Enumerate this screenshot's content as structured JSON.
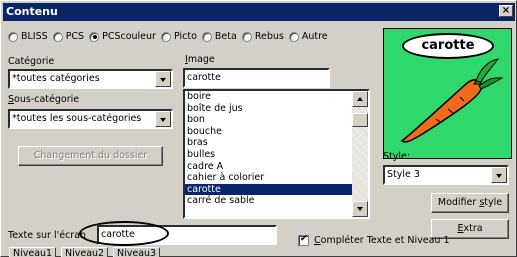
{
  "window": {
    "title": "Contenu",
    "close_label": "×"
  },
  "symbol_sets": [
    {
      "label": "BLISS",
      "selected": false
    },
    {
      "label": "PCS",
      "selected": false
    },
    {
      "label": "PCScouleur",
      "selected": true
    },
    {
      "label": "Picto",
      "selected": false
    },
    {
      "label": "Beta",
      "selected": false
    },
    {
      "label": "Rebus",
      "selected": false
    },
    {
      "label": "Autre",
      "selected": false
    }
  ],
  "category": {
    "label": "Catégorie",
    "value": "*toutes catégories"
  },
  "subcategory": {
    "label": "Sous-catégorie",
    "value": "*toutes les sous-catégories"
  },
  "change_folder_button": "Changement du dossier",
  "image": {
    "label": "Image",
    "value": "carotte",
    "list": [
      "boire",
      "boîte de jus",
      "bon",
      "bouche",
      "bras",
      "bulles",
      "cadre A",
      "cahier à colorier",
      "carotte",
      "carré de sable"
    ],
    "selected": "carotte"
  },
  "preview": {
    "title": "carotte",
    "image_name": "carrot-icon",
    "background": "#2fd86a"
  },
  "style": {
    "label": "Style:",
    "value": "Style 3"
  },
  "modify_style_button": "Modifier style",
  "extra_button": "Extra",
  "screen_text": {
    "label": "Texte sur l'écran",
    "value": "carotte"
  },
  "complete_checkbox": {
    "label": "Compléter Texte et Niveau 1",
    "checked": true
  },
  "tabs": [
    "Niveau1",
    "Niveau2",
    "Niveau3"
  ]
}
